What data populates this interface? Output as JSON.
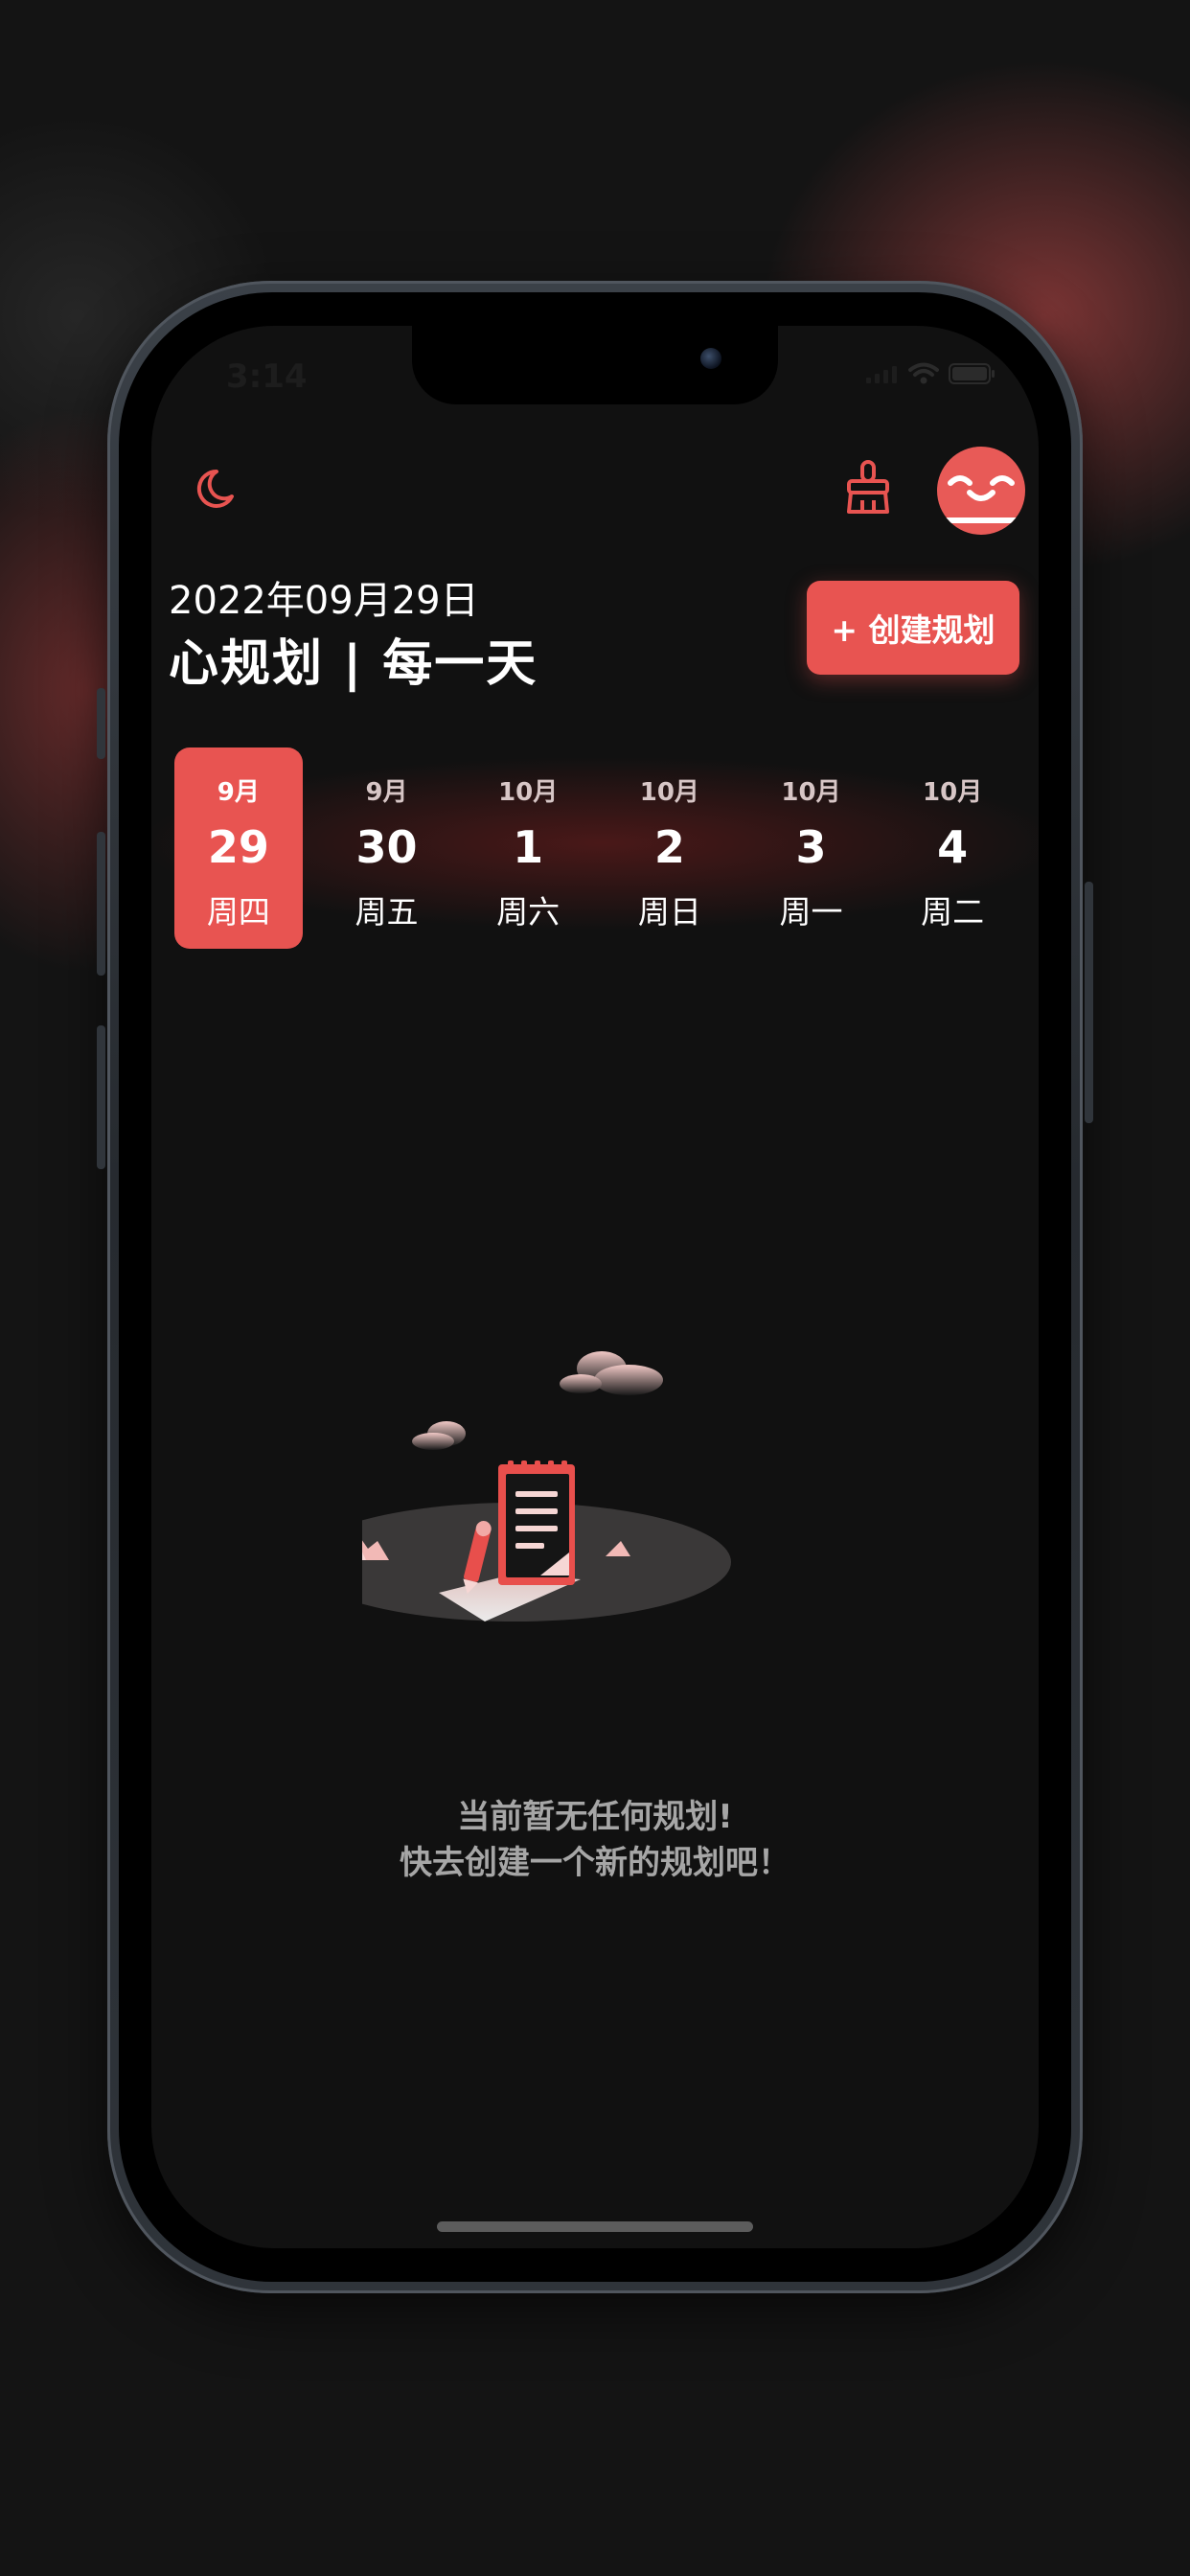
{
  "status_bar": {
    "time": "3:14",
    "wifi_icon": "wifi-icon",
    "battery_icon": "battery-icon"
  },
  "header": {
    "theme_toggle_icon": "moon-icon",
    "clear_icon": "broom-icon",
    "avatar_icon": "smiley-avatar-icon"
  },
  "title_block": {
    "date": "2022年09月29日",
    "app_title": "心规划 | 每一天"
  },
  "create_button": {
    "label": "+ 创建规划"
  },
  "days": [
    {
      "month": "9月",
      "day": "29",
      "weekday": "周四",
      "selected": true
    },
    {
      "month": "9月",
      "day": "30",
      "weekday": "周五",
      "selected": false
    },
    {
      "month": "10月",
      "day": "1",
      "weekday": "周六",
      "selected": false
    },
    {
      "month": "10月",
      "day": "2",
      "weekday": "周日",
      "selected": false
    },
    {
      "month": "10月",
      "day": "3",
      "weekday": "周一",
      "selected": false
    },
    {
      "month": "10月",
      "day": "4",
      "weekday": "周二",
      "selected": false
    }
  ],
  "empty_state": {
    "illustration_icon": "empty-notebook-illustration",
    "line1": "当前暂无任何规划!",
    "line2": "快去创建一个新的规划吧！"
  },
  "colors": {
    "accent": "#e85451",
    "background": "#111111",
    "text_primary": "#ffffff",
    "text_muted": "#a6a6a6"
  }
}
